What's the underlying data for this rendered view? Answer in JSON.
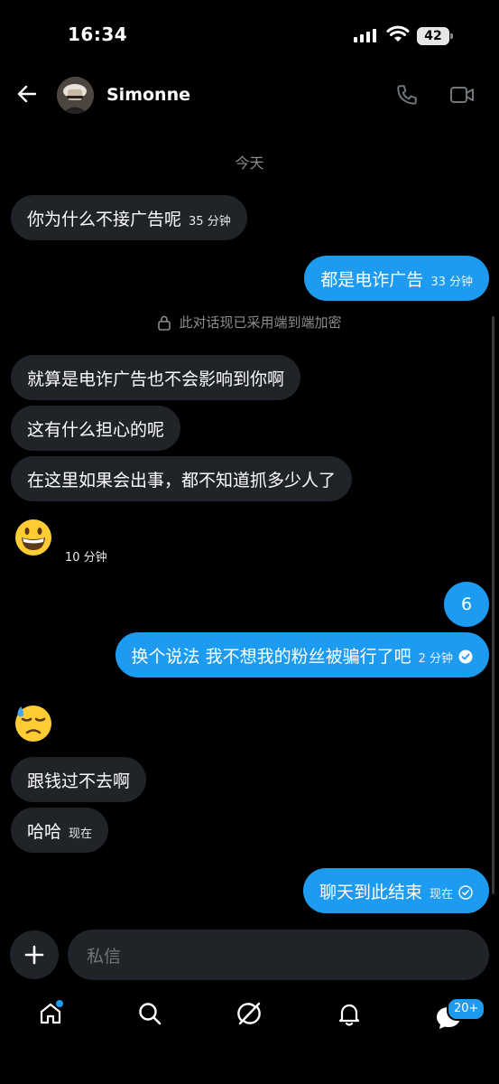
{
  "status": {
    "time": "16:34",
    "battery": "42"
  },
  "header": {
    "contact_name": "Simonne"
  },
  "conversation": {
    "date_label": "今天",
    "encryption_notice": "此对话现已采用端到端加密",
    "messages": [
      {
        "side": "in",
        "text": "你为什么不接广告呢",
        "time": "35 分钟"
      },
      {
        "side": "out",
        "text": "都是电诈广告",
        "time": "33 分钟"
      },
      {
        "side": "in",
        "text": "就算是电诈广告也不会影响到你啊"
      },
      {
        "side": "in",
        "text": "这有什么担心的呢"
      },
      {
        "side": "in",
        "text": "在这里如果会出事，都不知道抓多少人了"
      },
      {
        "side": "in",
        "emoji": "grinning-face",
        "time": "10 分钟"
      },
      {
        "side": "out",
        "text": "6"
      },
      {
        "side": "out",
        "text": "换个说法 我不想我的粉丝被骗行了吧",
        "time": "2 分钟",
        "status": "read"
      },
      {
        "side": "in",
        "emoji": "downcast-face-with-sweat"
      },
      {
        "side": "in",
        "text": "跟钱过不去啊"
      },
      {
        "side": "in",
        "text": "哈哈",
        "time": "现在"
      },
      {
        "side": "out",
        "text": "聊天到此结束",
        "time": "现在",
        "status": "sent"
      }
    ]
  },
  "composer": {
    "placeholder": "私信"
  },
  "tabbar": {
    "items": [
      "home-icon",
      "search-icon",
      "grok-icon",
      "notifications-icon",
      "messages-icon"
    ],
    "messages_badge": "20+"
  },
  "colors": {
    "accent": "#1d9bf0",
    "incoming_bubble": "#202327",
    "background": "#000000"
  }
}
